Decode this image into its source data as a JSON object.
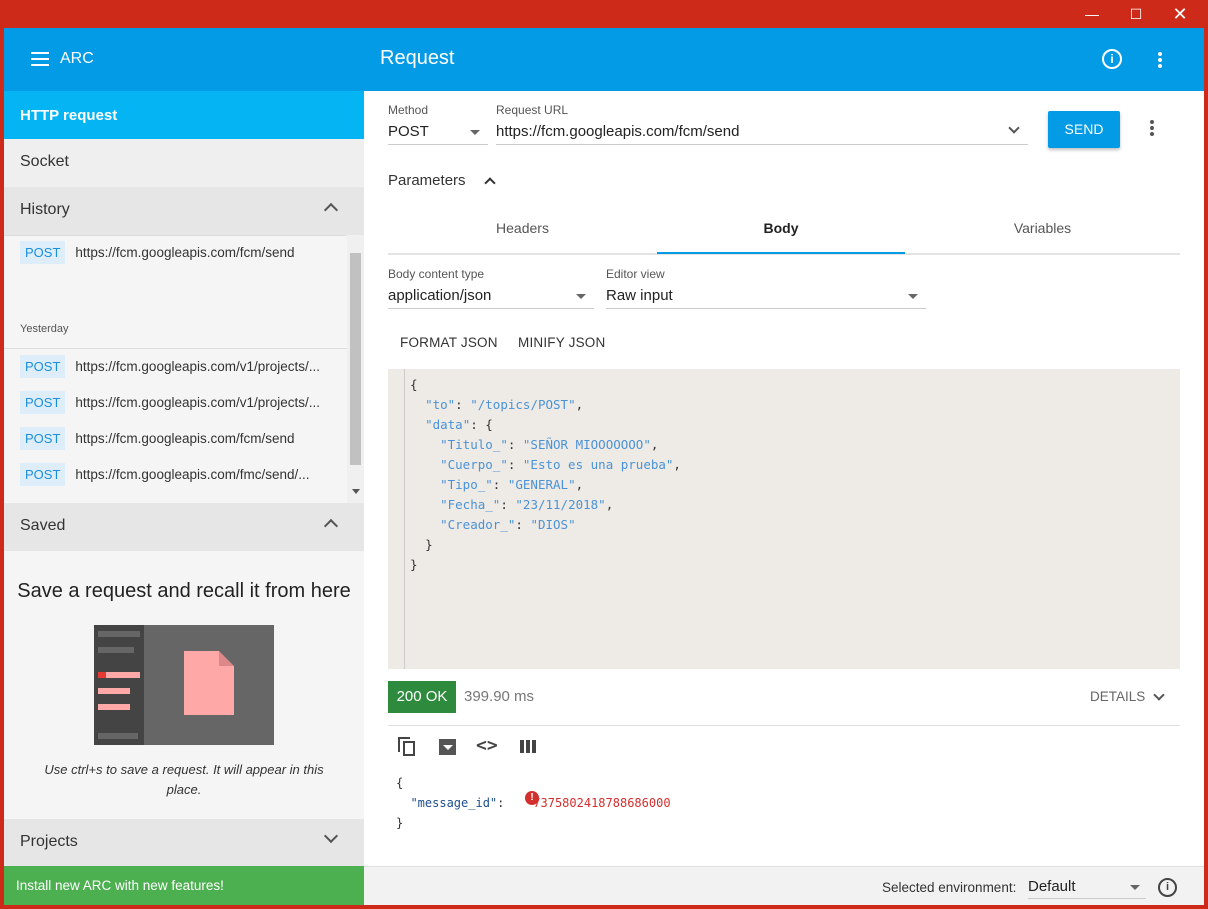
{
  "window": {
    "minimize": "—",
    "maximize": "☐",
    "close": "✕"
  },
  "sidebar": {
    "app_title": "ARC",
    "nav_http": "HTTP request",
    "nav_socket": "Socket",
    "nav_history": "History",
    "history": {
      "top_item": {
        "method": "POST",
        "url": "https://fcm.googleapis.com/fcm/send"
      },
      "group_label": "Yesterday",
      "items": [
        {
          "method": "POST",
          "url": "https://fcm.googleapis.com/v1/projects/..."
        },
        {
          "method": "POST",
          "url": "https://fcm.googleapis.com/v1/projects/..."
        },
        {
          "method": "POST",
          "url": "https://fcm.googleapis.com/fcm/send"
        },
        {
          "method": "POST",
          "url": "https://fcm.googleapis.com/fmc/send/..."
        }
      ]
    },
    "nav_saved": "Saved",
    "saved_title": "Save a request and recall it from here",
    "saved_hint": "Use ctrl+s to save a request. It will appear in this place.",
    "nav_projects": "Projects",
    "install_banner": "Install new ARC with new features!"
  },
  "main": {
    "title": "Request",
    "method_label": "Method",
    "method_value": "POST",
    "url_label": "Request URL",
    "url_value": "https://fcm.googleapis.com/fcm/send",
    "send_label": "SEND",
    "parameters_label": "Parameters",
    "tabs": [
      {
        "label": "Headers"
      },
      {
        "label": "Body",
        "active": true
      },
      {
        "label": "Variables"
      }
    ],
    "body_type_label": "Body content type",
    "body_type_value": "application/json",
    "editor_view_label": "Editor view",
    "editor_view_value": "Raw input",
    "format_json": "FORMAT JSON",
    "minify_json": "MINIFY JSON",
    "body_code": {
      "open": "{",
      "to_key": "\"to\"",
      "to_val": "\"/topics/POST\"",
      "data_key": "\"data\"",
      "fields": [
        {
          "key": "\"Titulo_\"",
          "value": "\"SEÑOR MIOOOOOOO\""
        },
        {
          "key": "\"Cuerpo_\"",
          "value": "\"Esto es una prueba\""
        },
        {
          "key": "\"Tipo_\"",
          "value": "\"GENERAL\""
        },
        {
          "key": "\"Fecha_\"",
          "value": "\"23/11/2018\""
        },
        {
          "key": "\"Creador_\"",
          "value": "\"DIOS\""
        }
      ],
      "close_inner": "}",
      "close": "}"
    },
    "response": {
      "status": "200 OK",
      "timing": "399.90 ms",
      "details": "DETAILS",
      "open": "{",
      "key": "\"message_id\"",
      "value": "7375802418788686000",
      "close": "}"
    },
    "footer": {
      "env_label": "Selected environment:",
      "env_value": "Default"
    }
  },
  "colors": {
    "titlebar": "#cd2a1a",
    "primary": "#039be5",
    "active_nav": "#04b4f3",
    "success": "#2e8b3d",
    "install": "#4caf50"
  }
}
